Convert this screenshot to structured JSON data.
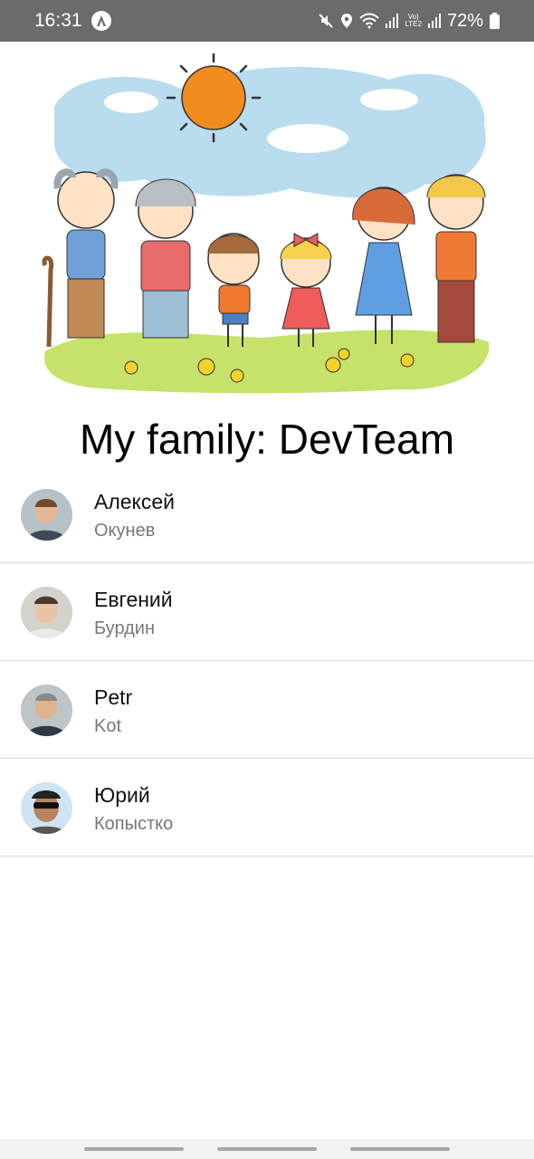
{
  "status": {
    "time": "16:31",
    "lte_label": "Vo)\nLTE2",
    "battery": "72%"
  },
  "header": {
    "title": "My family: DevTeam"
  },
  "people": [
    {
      "first": "Алексей",
      "last": "Окунев",
      "avatar": "avatar-photo"
    },
    {
      "first": "Евгений",
      "last": "Бурдин",
      "avatar": "avatar-photo"
    },
    {
      "first": "Petr",
      "last": "Kot",
      "avatar": "avatar-photo"
    },
    {
      "first": "Юрий",
      "last": "Копыстко",
      "avatar": "avatar-photo"
    }
  ],
  "colors": {
    "status_bar": "#6b6b6b",
    "divider": "#d9d9d9",
    "secondary_text": "#777777"
  }
}
